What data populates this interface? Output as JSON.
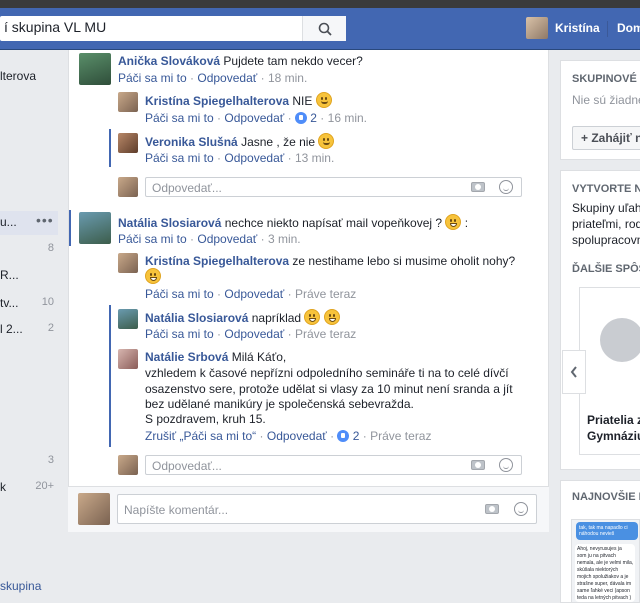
{
  "header": {
    "search_value": "í skupina VL MU",
    "user_name": "Kristína",
    "home_label": "Dom"
  },
  "sidebar": {
    "items": [
      {
        "label": "lterova",
        "count": ""
      },
      {
        "label": "u...",
        "count": ""
      },
      {
        "label": "",
        "count": "8"
      },
      {
        "label": "R...",
        "count": ""
      },
      {
        "label": "tv...",
        "count": "10"
      },
      {
        "label": "l 2...",
        "count": "2"
      },
      {
        "label": "",
        "count": "3"
      },
      {
        "label": "k",
        "count": "20+"
      }
    ],
    "more_label": "•••",
    "bottom_link": "skupina"
  },
  "feed": {
    "comments": [
      {
        "author": "Anička Slováková",
        "text": "Pujdete tam nekdo vecer?",
        "like": "Páči sa mi to",
        "reply": "Odpovedať",
        "time": "18 min.",
        "replies": [
          {
            "author": "Kristína Spiegelhalterova",
            "text": "NIE",
            "like": "Páči sa mi to",
            "reply": "Odpovedať",
            "reactions": "2",
            "time": "16 min."
          },
          {
            "author": "Veronika Slušná",
            "text": "Jasne , že nie",
            "like": "Páči sa mi to",
            "reply": "Odpovedať",
            "time": "13 min."
          }
        ],
        "reply_placeholder": "Odpovedať..."
      },
      {
        "author": "Natália Slosiarová",
        "text": "nechce niekto napísať mail vopeňkovej ?",
        "text_tail": ":",
        "like": "Páči sa mi to",
        "reply": "Odpovedať",
        "time": "3 min.",
        "replies": [
          {
            "author": "Kristína Spiegelhalterova",
            "text": "ze nestihame lebo si musime oholit nohy?",
            "like": "Páči sa mi to",
            "reply": "Odpovedať",
            "time": "Práve teraz"
          },
          {
            "author": "Natália Slosiarová",
            "text": "napríklad",
            "like": "Páči sa mi to",
            "reply": "Odpovedať",
            "time": "Práve teraz"
          },
          {
            "author": "Natálie Srbová",
            "text": "Milá Káťo,",
            "lines": [
              "vzhledem k časové nepřízni odpoledního semináře ti na to celé dívčí",
              "osazenstvo sere, protože udělat si vlasy za 10 minut není sranda a jít",
              "bez udělané manikúry je společenská sebevražda.",
              "S pozdravem, kruh 15."
            ],
            "like": "Zrušiť „Páči sa mi to“",
            "reply": "Odpovedať",
            "reactions": "2",
            "time": "Práve teraz"
          }
        ],
        "reply_placeholder": "Odpovedať..."
      }
    ],
    "compose_placeholder": "Napíšte komentár..."
  },
  "right": {
    "group_header": "SKUPINOVÉ K",
    "group_empty": "Nie sú žiadne",
    "start_button": "+ Zahájiť n",
    "create_header": "VYTVORTE N",
    "create_lines": [
      "Skupiny uľahč",
      "priateľmi, rod",
      "spolupracovn"
    ],
    "more_header": "ĎALŠIE SPÔS",
    "suggestion_lines": [
      "Priatelia z",
      "Gymnáziu"
    ],
    "newest_header": "NAJNOVŠIE F",
    "chat_lines": [
      "tak, tak ma napadlo ci",
      "náhodou nevieš"
    ],
    "chat_lines2": [
      "Ahoj, nevyrusujes ja",
      "som ju na pitvach",
      "nemala, ale je velmi mila,",
      "skúšala niektorých",
      "mojich spolužiakov a je",
      "strašne super, dávala im",
      "same ľahké veci (apson",
      "teda na letných pitvach )"
    ]
  },
  "colors": {
    "brand": "#4267b2",
    "link": "#385898",
    "meta": "#90949c"
  }
}
